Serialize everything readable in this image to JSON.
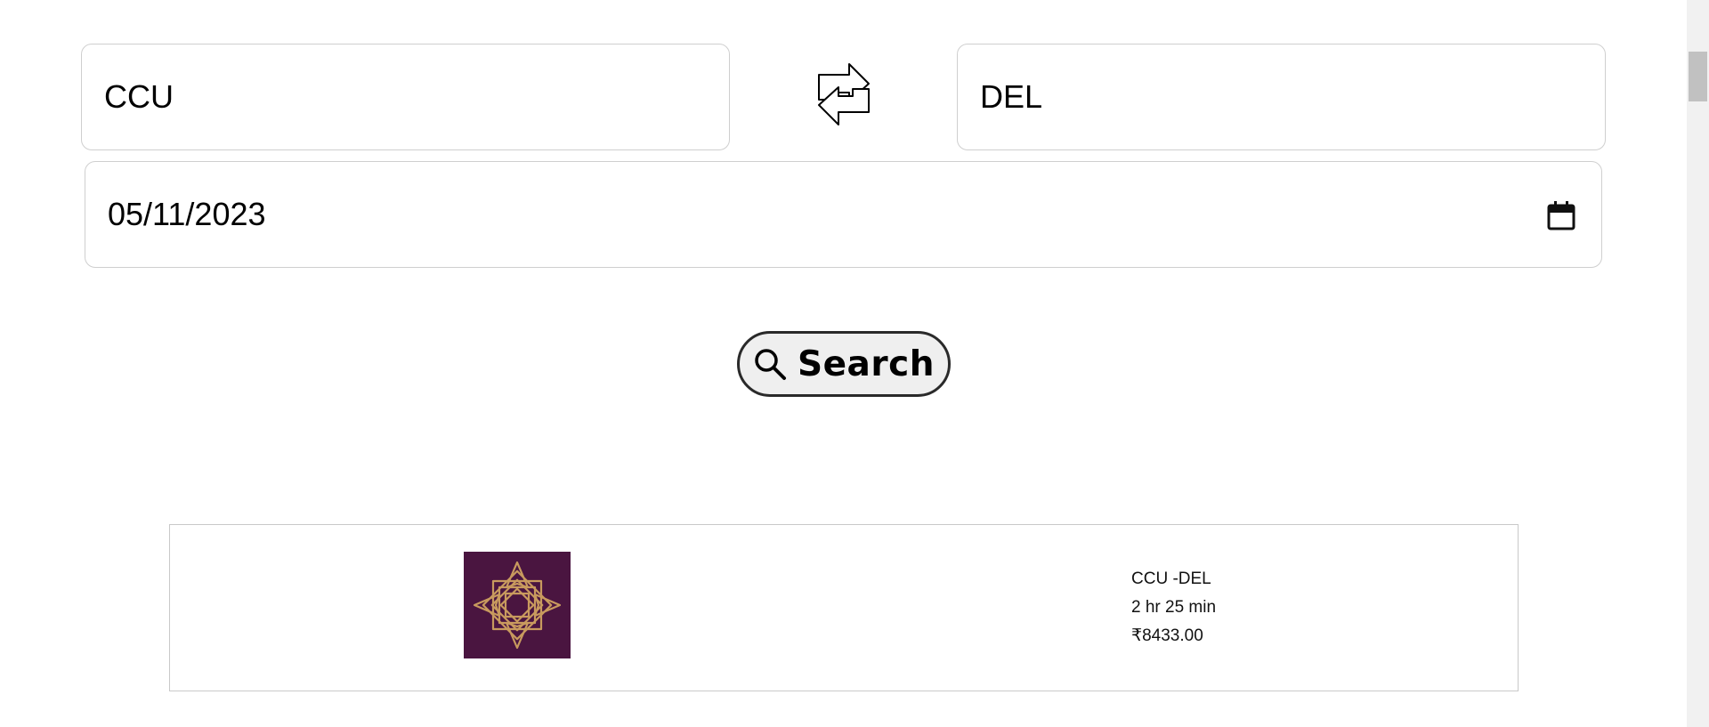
{
  "form": {
    "origin_value": "CCU",
    "destination_value": "DEL",
    "date_value": "05/11/2023",
    "search_label": "Search"
  },
  "icons": {
    "swap": "swap-arrows-icon",
    "calendar": "calendar-icon",
    "search": "search-icon",
    "airline_logo": "airline-logo"
  },
  "results": [
    {
      "route": "CCU -DEL",
      "duration": "2 hr 25 min",
      "price": "₹8433.00"
    }
  ],
  "colors": {
    "logo_background": "#4a1540",
    "logo_gold": "#c89a5e",
    "search_button_bg": "#efefef"
  }
}
